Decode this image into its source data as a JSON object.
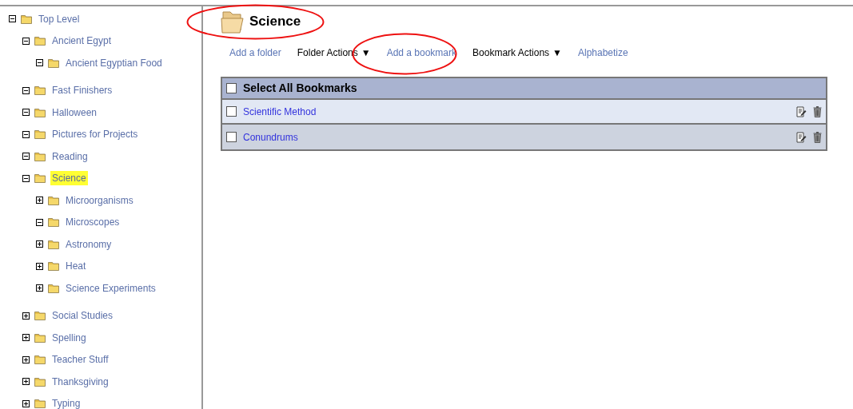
{
  "tree": [
    {
      "label": "Top Level",
      "expanded": true,
      "selected": false,
      "children": [
        {
          "label": "Ancient Egypt",
          "expanded": true,
          "selected": false,
          "children": [
            {
              "label": "Ancient Egyptian Food",
              "expanded": true,
              "selected": false
            }
          ]
        },
        {
          "label": "Fast Finishers",
          "expanded": true,
          "selected": false
        },
        {
          "label": "Halloween",
          "expanded": true,
          "selected": false
        },
        {
          "label": "Pictures for Projects",
          "expanded": true,
          "selected": false
        },
        {
          "label": "Reading",
          "expanded": true,
          "selected": false
        },
        {
          "label": "Science",
          "expanded": true,
          "selected": true,
          "children": [
            {
              "label": "Microorganisms",
              "expanded": false,
              "selected": false
            },
            {
              "label": "Microscopes",
              "expanded": true,
              "selected": false
            },
            {
              "label": "Astronomy",
              "expanded": false,
              "selected": false
            },
            {
              "label": "Heat",
              "expanded": false,
              "selected": false
            },
            {
              "label": "Science Experiments",
              "expanded": false,
              "selected": false
            }
          ]
        },
        {
          "label": "Social Studies",
          "expanded": false,
          "selected": false
        },
        {
          "label": "Spelling",
          "expanded": false,
          "selected": false
        },
        {
          "label": "Teacher Stuff",
          "expanded": false,
          "selected": false
        },
        {
          "label": "Thanksgiving",
          "expanded": false,
          "selected": false
        },
        {
          "label": "Typing",
          "expanded": false,
          "selected": false
        }
      ]
    }
  ],
  "folder": {
    "title": "Science"
  },
  "toolbar": [
    {
      "label": "Add a folder",
      "kind": "link"
    },
    {
      "label": "Folder Actions",
      "kind": "menu",
      "caret": "▼"
    },
    {
      "label": "Add a bookmark",
      "kind": "link"
    },
    {
      "label": "Bookmark Actions",
      "kind": "menu",
      "caret": "▼"
    },
    {
      "label": "Alphabetize",
      "kind": "link"
    }
  ],
  "bookmarks": {
    "header": {
      "label": "Select All Bookmarks",
      "checked": false
    },
    "rows": [
      {
        "label": "Scientific Method",
        "checked": false
      },
      {
        "label": "Conundrums",
        "checked": false
      }
    ]
  }
}
